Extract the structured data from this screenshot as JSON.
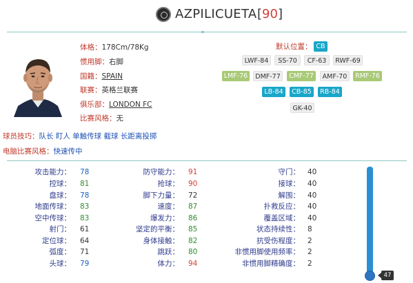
{
  "header": {
    "player_name": "AZPILICUETA",
    "ovr": "90",
    "bracket_open": "[",
    "bracket_close": "]"
  },
  "profile": {
    "height_weight": {
      "key": "体格：",
      "value": "178Cm/78Kg"
    },
    "foot": {
      "key": "惯用脚：",
      "value": "右脚"
    },
    "nation": {
      "key": "国籍：",
      "value": "SPAIN"
    },
    "league": {
      "key": "联赛：",
      "value": "英格兰联赛"
    },
    "club": {
      "key": "俱乐部：",
      "value": "LONDON FC"
    },
    "style": {
      "key": "比赛风格：",
      "value": "无"
    }
  },
  "positions": {
    "title": "默认位置：",
    "current": "CB",
    "badges": [
      {
        "label": "LWF-84",
        "style": "gray"
      },
      {
        "label": "SS-70",
        "style": "gray"
      },
      {
        "label": "CF-63",
        "style": "gray"
      },
      {
        "label": "RWF-69",
        "style": "gray"
      },
      {
        "label": "LMF-76",
        "style": "green"
      },
      {
        "label": "DMF-77",
        "style": "gray"
      },
      {
        "label": "CMF-77",
        "style": "green"
      },
      {
        "label": "AMF-70",
        "style": "gray"
      },
      {
        "label": "RMF-76",
        "style": "green"
      },
      {
        "label": "LB-84",
        "style": "blue"
      },
      {
        "label": "CB-85",
        "style": "blue"
      },
      {
        "label": "RB-84",
        "style": "blue"
      },
      {
        "label": "GK-40",
        "style": "gray"
      }
    ]
  },
  "skills": {
    "key": "球员技巧：",
    "value": "队长 盯人 单触传球 截球 长距离投掷"
  },
  "ai_style": {
    "key": "电脑比赛风格：",
    "value": "快速传中"
  },
  "stats": {
    "col1": [
      {
        "label": "攻击能力：",
        "value": "78",
        "color": "#1a5fc4"
      },
      {
        "label": "控球：",
        "value": "81",
        "color": "#2e8b2e"
      },
      {
        "label": "盘球：",
        "value": "78",
        "color": "#1a5fc4"
      },
      {
        "label": "地面传球：",
        "value": "83",
        "color": "#2e8b2e"
      },
      {
        "label": "空中传球：",
        "value": "83",
        "color": "#2e8b2e"
      },
      {
        "label": "射门：",
        "value": "61",
        "color": "#333333"
      },
      {
        "label": "定位球：",
        "value": "64",
        "color": "#333333"
      },
      {
        "label": "弧度：",
        "value": "71",
        "color": "#333333"
      },
      {
        "label": "头球：",
        "value": "79",
        "color": "#1a5fc4"
      }
    ],
    "col2": [
      {
        "label": "防守能力：",
        "value": "91",
        "color": "#d43f3a"
      },
      {
        "label": "抢球：",
        "value": "90",
        "color": "#d43f3a"
      },
      {
        "label": "脚下力量：",
        "value": "72",
        "color": "#333333"
      },
      {
        "label": "速度：",
        "value": "87",
        "color": "#2e8b2e"
      },
      {
        "label": "爆发力：",
        "value": "86",
        "color": "#2e8b2e"
      },
      {
        "label": "坚定的平衡：",
        "value": "85",
        "color": "#2e8b2e"
      },
      {
        "label": "身体接触：",
        "value": "82",
        "color": "#2e8b2e"
      },
      {
        "label": "跳跃：",
        "value": "80",
        "color": "#2e8b2e"
      },
      {
        "label": "体力：",
        "value": "94",
        "color": "#d43f3a"
      }
    ],
    "col3": [
      {
        "label": "守门：",
        "value": "40",
        "color": "#333333"
      },
      {
        "label": "接球：",
        "value": "40",
        "color": "#333333"
      },
      {
        "label": "解围：",
        "value": "40",
        "color": "#333333"
      },
      {
        "label": "扑救反应：",
        "value": "40",
        "color": "#333333"
      },
      {
        "label": "覆盖区域：",
        "value": "40",
        "color": "#333333"
      },
      {
        "label": "状态持续性：",
        "value": "8",
        "color": "#333333"
      },
      {
        "label": "抗受伤程度：",
        "value": "2",
        "color": "#333333"
      },
      {
        "label": "非惯用脚使用频率：",
        "value": "2",
        "color": "#333333"
      },
      {
        "label": "非惯用脚精确度：",
        "value": "2",
        "color": "#333333"
      }
    ]
  },
  "level_slider": {
    "value": "47"
  }
}
